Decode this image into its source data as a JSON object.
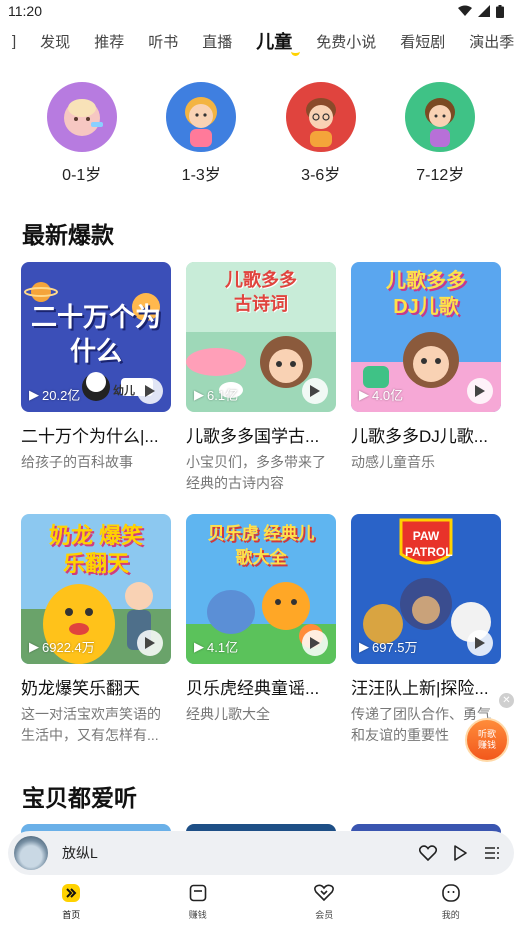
{
  "status_bar": {
    "time": "11:20"
  },
  "tabs": [
    {
      "label": "]",
      "active": false
    },
    {
      "label": "发现",
      "active": false
    },
    {
      "label": "推荐",
      "active": false
    },
    {
      "label": "听书",
      "active": false
    },
    {
      "label": "直播",
      "active": false
    },
    {
      "label": "儿童",
      "active": true
    },
    {
      "label": "免费小说",
      "active": false
    },
    {
      "label": "看短剧",
      "active": false
    },
    {
      "label": "演出季",
      "active": false
    }
  ],
  "age_groups": [
    {
      "label": "0-1岁",
      "color": "#b77be0"
    },
    {
      "label": "1-3岁",
      "color": "#3f7fe0"
    },
    {
      "label": "3-6岁",
      "color": "#e0443e"
    },
    {
      "label": "7-12岁",
      "color": "#3fc286"
    }
  ],
  "sections": {
    "latest": "最新爆款",
    "favorites": "宝贝都爱听"
  },
  "cards": [
    {
      "cover_text": "二十万个为什么",
      "cover_tag": "幼儿",
      "play_count": "20.2亿",
      "title": "二十万个为什么|...",
      "desc": "给孩子的百科故事",
      "bg": "#3b4fb8"
    },
    {
      "cover_text": "儿歌多多 古诗词",
      "cover_tag": "",
      "play_count": "6.1亿",
      "title": "儿歌多多国学古...",
      "desc": "小宝贝们，多多带来了经典的古诗内容",
      "bg": "#9ed8b8"
    },
    {
      "cover_text": "儿歌多多 DJ儿歌",
      "cover_tag": "",
      "play_count": "4.0亿",
      "title": "儿歌多多DJ儿歌...",
      "desc": "动感儿童音乐",
      "bg": "#5aa6ef"
    },
    {
      "cover_text": "奶龙 爆笑乐翻天",
      "cover_tag": "",
      "play_count": "6922.4万",
      "title": "奶龙爆笑乐翻天",
      "desc": "这一对活宝欢声笑语的生活中，又有怎样有...",
      "bg": "#8cc8f0"
    },
    {
      "cover_text": "贝乐虎 经典儿歌大全",
      "cover_tag": "",
      "play_count": "4.1亿",
      "title": "贝乐虎经典童谣...",
      "desc": "经典儿歌大全",
      "bg": "#5fb5f0"
    },
    {
      "cover_text": "PAW PATROL",
      "cover_tag": "",
      "play_count": "697.5万",
      "title": "汪汪队上新|探险...",
      "desc": "传递了团队合作、勇气和友谊的重要性",
      "bg": "#2a63c8"
    }
  ],
  "reward": {
    "line1": "听歌",
    "line2": "赚钱"
  },
  "player": {
    "title": "放纵L"
  },
  "nav": [
    {
      "label": "首页",
      "icon": "home-icon",
      "active": true
    },
    {
      "label": "赚钱",
      "icon": "wallet-icon",
      "active": false
    },
    {
      "label": "会员",
      "icon": "vip-heart-icon",
      "active": false
    },
    {
      "label": "我的",
      "icon": "profile-icon",
      "active": false
    }
  ]
}
